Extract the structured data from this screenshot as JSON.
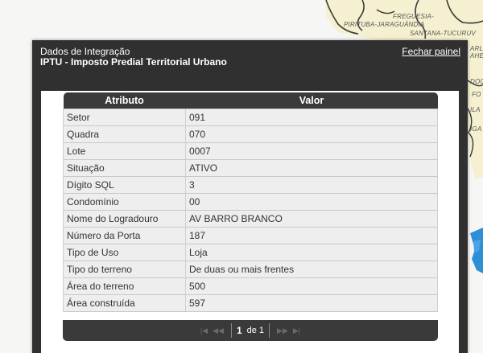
{
  "map": {
    "labels": {
      "freguesia": "FREGUESIA-",
      "pirituba": "PIRITUBA-JARAGUÁNDIA",
      "santana": "SANTANA-TUCURUV",
      "arl": "ARL",
      "ahe": "AHE",
      "doc": "DOC",
      "fo": "FO",
      "ila": "ILA",
      "iga": "IGA"
    }
  },
  "panel": {
    "subtitle": "Dados de Integração",
    "title": "IPTU - Imposto Predial Territorial Urbano",
    "close_label": "Fechar painel"
  },
  "table": {
    "headers": {
      "attribute": "Atributo",
      "value": "Valor"
    },
    "rows": [
      {
        "attribute": "Setor",
        "value": "091"
      },
      {
        "attribute": "Quadra",
        "value": "070"
      },
      {
        "attribute": "Lote",
        "value": "0007"
      },
      {
        "attribute": "Situação",
        "value": "ATIVO"
      },
      {
        "attribute": "Dígito SQL",
        "value": "3"
      },
      {
        "attribute": "Condomínio",
        "value": "00"
      },
      {
        "attribute": "Nome do Logradouro",
        "value": "AV BARRO BRANCO"
      },
      {
        "attribute": "Número da Porta",
        "value": "187"
      },
      {
        "attribute": "Tipo de Uso",
        "value": "Loja"
      },
      {
        "attribute": "Tipo do terreno",
        "value": "De duas ou mais frentes"
      },
      {
        "attribute": "Área do terreno",
        "value": "500"
      },
      {
        "attribute": "Área construída",
        "value": "597"
      }
    ]
  },
  "pager": {
    "current_page": "1",
    "of_text": "de 1",
    "first_icon": "first-page-icon",
    "prev_icon": "prev-page-icon",
    "next_icon": "next-page-icon",
    "last_icon": "last-page-icon"
  }
}
